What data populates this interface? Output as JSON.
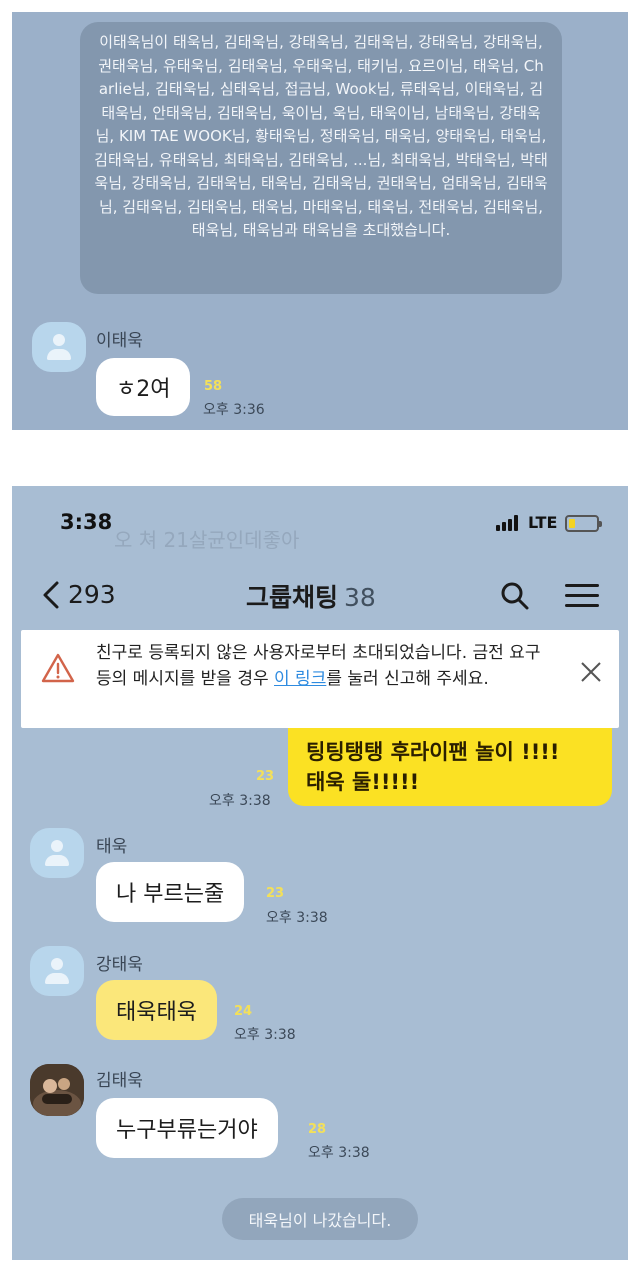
{
  "panel1": {
    "invite_notice": "이태욱님이 태욱님, 김태욱님, 강태욱님, 김태욱님, 강태욱님, 강태욱님, 권태욱님, 유태욱님, 김태욱님, 우태욱님, 태키님, 요르이님, 태욱님, Charlie님, 김태욱님, 심태욱님, 접금님, Wook님, 류태욱님, 이태욱님, 김태욱님, 안태욱님, 김태욱님, 욱이님, 욱님, 태욱이님, 남태욱님, 강태욱님, KIM TAE WOOK님, 황태욱님, 정태욱님, 태욱님, 양태욱님, 태욱님, 김태욱님, 유태욱님, 최태욱님, 김태욱님, ...님, 최태욱님, 박태욱님, 박태욱님, 강태욱님, 김태욱님, 태욱님, 김태욱님, 권태욱님, 엄태욱님, 김태욱님, 김태욱님, 김태욱님, 태욱님, 마태욱님, 태욱님, 전태욱님, 김태욱님, 태욱님, 태욱님과 태욱님을 초대했습니다.",
    "message": {
      "sender": "이태욱",
      "text": "ㅎ2여",
      "unread": "58",
      "time": "오후 3:36"
    }
  },
  "panel2": {
    "status_bar": {
      "time": "3:38",
      "ghost_text": "오 쳐 21살균인데좋아",
      "network": "LTE"
    },
    "nav": {
      "back_count": "293",
      "title": "그룹채팅",
      "member_count": "38"
    },
    "warning": {
      "text_before": "친구로 등록되지 않은 사용자로부터 초대되었습니다. 금전 요구 등의 메시지를 받을 경우 ",
      "link": "이 링크",
      "text_after": "를 눌러 신고해 주세요."
    },
    "my_message": {
      "line1": "팅팅탱탱 후라이팬 놀이 !!!!",
      "line2": "태욱 둘!!!!!",
      "unread": "23",
      "time": "오후 3:38"
    },
    "messages": [
      {
        "sender": "태욱",
        "text": "나 부르는줄",
        "unread": "23",
        "time": "오후 3:38"
      },
      {
        "sender": "강태욱",
        "text": "태욱태욱",
        "unread": "24",
        "time": "오후 3:38"
      },
      {
        "sender": "김태욱",
        "text": "누구부류는거야",
        "unread": "28",
        "time": "오후 3:38"
      }
    ],
    "system_message": "태욱님이 나갔습니다."
  },
  "colors": {
    "chat_background": "#a8bdd3",
    "my_bubble": "#fbe123",
    "unread_count": "#f3e05a",
    "link": "#2e8be0"
  },
  "icons": [
    "back-arrow-icon",
    "search-icon",
    "menu-icon",
    "warning-icon",
    "close-icon",
    "avatar-placeholder-icon",
    "signal-icon",
    "battery-icon"
  ]
}
